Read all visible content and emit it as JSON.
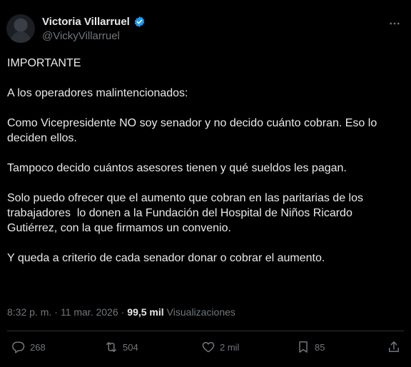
{
  "author": {
    "name": "Victoria Villarruel",
    "handle": "@VickyVillarruel"
  },
  "post": {
    "paragraphs": [
      "IMPORTANTE",
      "A los operadores malintencionados:",
      "Como Vicepresidente NO soy senador y no decido cuánto cobran. Eso lo deciden ellos.",
      "Tampoco decido cuántos asesores tienen y qué sueldos les pagan.",
      "Solo puedo ofrecer que el aumento que cobran en las paritarias de los trabajadores  lo donen a la Fundación del Hospital de Niños Ricardo Gutiérrez, con la que firmamos un convenio.",
      "Y queda a criterio de cada senador donar o cobrar el aumento."
    ],
    "time": "8:32 p. m.",
    "separator": "·",
    "date": "11 mar. 2026",
    "views_count": "99,5 mil",
    "views_label": "Visualizaciones"
  },
  "actions": {
    "replies": "268",
    "reposts": "504",
    "likes": "2 mil",
    "bookmarks": "85"
  },
  "icons": {
    "verified": "verified-badge-icon",
    "more": "more-options-icon",
    "reply": "reply-icon",
    "repost": "repost-icon",
    "like": "heart-icon",
    "bookmark": "bookmark-icon",
    "share": "share-icon"
  },
  "colors": {
    "background": "#000000",
    "text": "#e7e9ea",
    "muted": "#71767b",
    "verified": "#1d9bf0",
    "divider": "#2f3336"
  }
}
